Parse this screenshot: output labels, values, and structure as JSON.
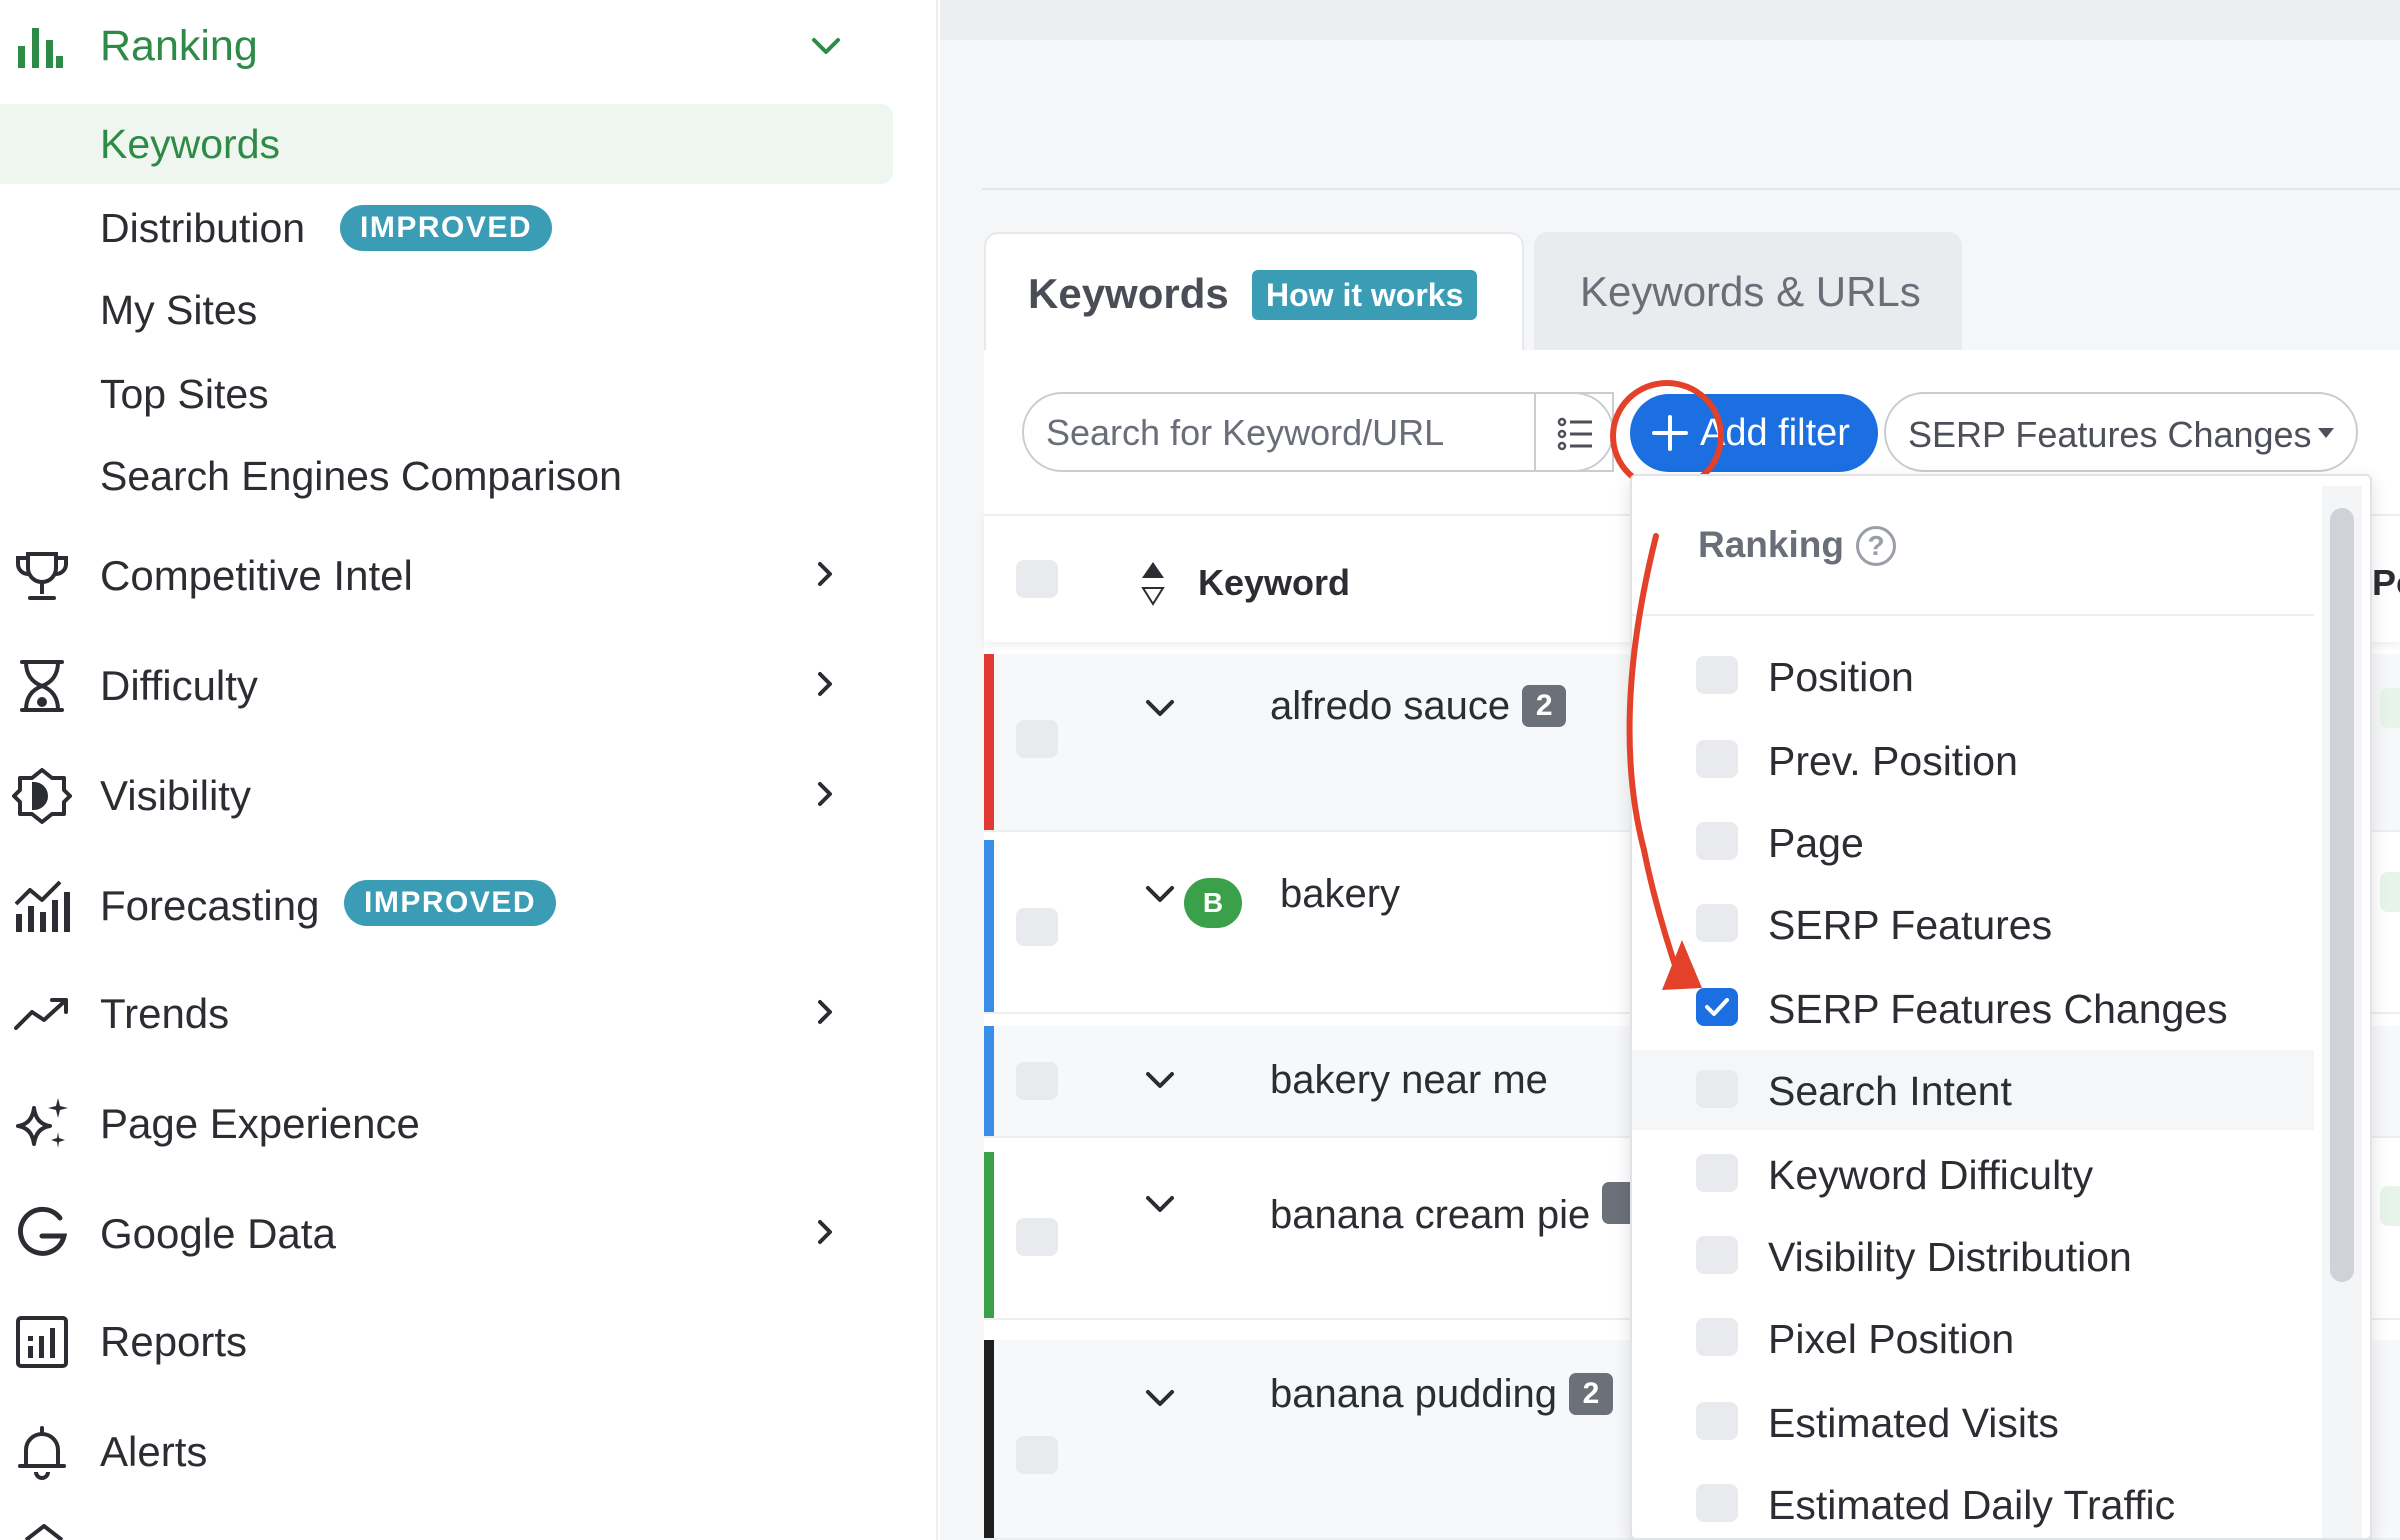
{
  "sidebar": {
    "section": {
      "label": "Ranking",
      "icon": "bar-chart-icon",
      "expanded": true
    },
    "subitems": [
      {
        "label": "Keywords",
        "active": true
      },
      {
        "label": "Distribution",
        "badge": "IMPROVED"
      },
      {
        "label": "My Sites"
      },
      {
        "label": "Top Sites"
      },
      {
        "label": "Search Engines Comparison"
      }
    ],
    "items": [
      {
        "label": "Competitive Intel",
        "icon": "trophy-icon",
        "has_chevron": true
      },
      {
        "label": "Difficulty",
        "icon": "hourglass-icon",
        "has_chevron": true
      },
      {
        "label": "Visibility",
        "icon": "visibility-icon",
        "has_chevron": true
      },
      {
        "label": "Forecasting",
        "icon": "forecast-icon",
        "badge": "IMPROVED"
      },
      {
        "label": "Trends",
        "icon": "trend-icon",
        "has_chevron": true
      },
      {
        "label": "Page Experience",
        "icon": "sparkle-icon"
      },
      {
        "label": "Google Data",
        "icon": "google-icon",
        "has_chevron": true
      },
      {
        "label": "Reports",
        "icon": "report-icon"
      },
      {
        "label": "Alerts",
        "icon": "bell-icon"
      }
    ]
  },
  "tabs": {
    "keywords": {
      "label": "Keywords",
      "badge": "How it works"
    },
    "keywords_urls": {
      "label": "Keywords & URLs"
    }
  },
  "toolbar": {
    "search_placeholder": "Search for Keyword/URL",
    "add_filter_label": "Add filter",
    "serp_dropdown_label": "SERP Features Changes"
  },
  "table": {
    "headers": {
      "keyword": "Keyword",
      "position_partial": "Po"
    },
    "rows": [
      {
        "keyword": "alfredo sauce",
        "count": "2",
        "bar_color": "#e03a33"
      },
      {
        "keyword": "bakery",
        "tag": "B",
        "bar_color": "#3a8de8"
      },
      {
        "keyword": "bakery near me",
        "bar_color": "#3a8de8"
      },
      {
        "keyword": "banana cream pie",
        "count": "",
        "bar_color": "#3aa04a"
      },
      {
        "keyword": "banana pudding",
        "count": "2",
        "bar_color": "#1e1e1e"
      }
    ]
  },
  "filter_dropdown": {
    "header": "Ranking",
    "help": "?",
    "options": [
      {
        "label": "Position",
        "checked": false
      },
      {
        "label": "Prev. Position",
        "checked": false
      },
      {
        "label": "Page",
        "checked": false
      },
      {
        "label": "SERP Features",
        "checked": false
      },
      {
        "label": "SERP Features Changes",
        "checked": true
      },
      {
        "label": "Search Intent",
        "checked": false,
        "hovered": true
      },
      {
        "label": "Keyword Difficulty",
        "checked": false
      },
      {
        "label": "Visibility Distribution",
        "checked": false
      },
      {
        "label": "Pixel Position",
        "checked": false
      },
      {
        "label": "Estimated Visits",
        "checked": false
      },
      {
        "label": "Estimated Daily Traffic",
        "checked": false
      }
    ]
  },
  "colors": {
    "brand_green": "#2e8b47",
    "badge_teal": "#3a9db5",
    "primary_blue": "#1b6fe0",
    "annotation_red": "#e4412a"
  }
}
